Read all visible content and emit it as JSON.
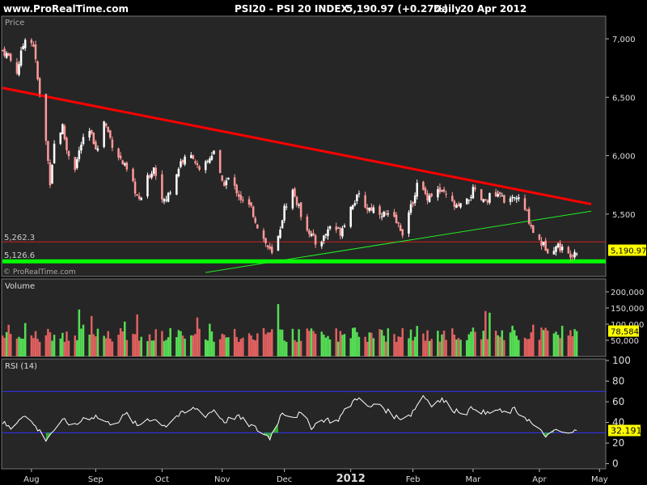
{
  "header": {
    "site": "www.ProRealTime.com",
    "instrument": "PSI20 - PSI 20 INDEX",
    "quote": "5,190.97 (+0.27%)",
    "period": "Daily",
    "date": "20 Apr 2012"
  },
  "panels": {
    "price_label": "Price",
    "volume_label": "Volume",
    "rsi_label": "RSI (14)",
    "watermark": "© ProRealTime.com"
  },
  "colors": {
    "background": "#000000",
    "panel_bg": "#262626",
    "up_candle": "#ffffff",
    "down_candle": "#ff9999",
    "up_volume": "#55dd55",
    "down_volume": "#e06060",
    "trendline_red": "#ff0000",
    "trendline_green": "#22ee22",
    "support": "#00ff00",
    "ref_line": "#cc2222",
    "rsi_line": "#ffffff",
    "rsi_bands": "#3333ff",
    "last_value_box": "#ffff00"
  },
  "chart_data": [
    {
      "type": "candlestick",
      "panel": "price",
      "title": "PSI20 - PSI 20 INDEX",
      "y_ticks": [
        "7,000",
        "6,500",
        "6,000",
        "5,500"
      ],
      "y_tick_values": [
        7000,
        6500,
        6000,
        5500
      ],
      "ylim": [
        4980,
        7180
      ],
      "x_ticks": [
        "Aug",
        "Sep",
        "Oct",
        "Nov",
        "Dec",
        "2012",
        "Feb",
        "Mar",
        "Apr",
        "May"
      ],
      "date_range": [
        "2011-07-18",
        "2012-04-20"
      ],
      "last_value": "5,190.97",
      "ref_levels": [
        {
          "label": "5,262.3",
          "value": 5262.3,
          "color": "#cc2222"
        },
        {
          "label": "5,126.6",
          "value": 5126.6,
          "color": "#00ff00"
        }
      ],
      "trendlines": [
        {
          "name": "resistance",
          "color": "#ff0000",
          "from": [
            "2011-07-18",
            6580
          ],
          "to": [
            "2012-04-27",
            5585
          ]
        },
        {
          "name": "support",
          "color": "#22ee22",
          "from": [
            "2011-10-24",
            5000
          ],
          "to": [
            "2012-04-27",
            5525
          ]
        }
      ],
      "close_path": [
        [
          "2011-07-18",
          6900
        ],
        [
          "2011-07-21",
          6850
        ],
        [
          "2011-07-25",
          6720
        ],
        [
          "2011-07-29",
          7020
        ],
        [
          "2011-08-02",
          6950
        ],
        [
          "2011-08-04",
          6650
        ],
        [
          "2011-08-08",
          6120
        ],
        [
          "2011-08-10",
          5780
        ],
        [
          "2011-08-12",
          6100
        ],
        [
          "2011-08-16",
          6250
        ],
        [
          "2011-08-18",
          6050
        ],
        [
          "2011-08-22",
          5900
        ],
        [
          "2011-08-25",
          6100
        ],
        [
          "2011-08-29",
          6200
        ],
        [
          "2011-09-02",
          6050
        ],
        [
          "2011-09-05",
          6300
        ],
        [
          "2011-09-09",
          6100
        ],
        [
          "2011-09-12",
          6000
        ],
        [
          "2011-09-15",
          5900
        ],
        [
          "2011-09-19",
          5750
        ],
        [
          "2011-09-22",
          5600
        ],
        [
          "2011-09-26",
          5800
        ],
        [
          "2011-09-29",
          5900
        ],
        [
          "2011-10-04",
          5600
        ],
        [
          "2011-10-07",
          5700
        ],
        [
          "2011-10-12",
          5950
        ],
        [
          "2011-10-18",
          6000
        ],
        [
          "2011-10-21",
          5850
        ],
        [
          "2011-10-25",
          5950
        ],
        [
          "2011-10-28",
          6050
        ],
        [
          "2011-11-01",
          5750
        ],
        [
          "2011-11-04",
          5800
        ],
        [
          "2011-11-08",
          5700
        ],
        [
          "2011-11-11",
          5600
        ],
        [
          "2011-11-15",
          5550
        ],
        [
          "2011-11-18",
          5400
        ],
        [
          "2011-11-22",
          5250
        ],
        [
          "2011-11-25",
          5150
        ],
        [
          "2011-11-28",
          5300
        ],
        [
          "2011-12-01",
          5550
        ],
        [
          "2011-12-05",
          5700
        ],
        [
          "2011-12-09",
          5500
        ],
        [
          "2011-12-13",
          5350
        ],
        [
          "2011-12-16",
          5250
        ],
        [
          "2011-12-20",
          5300
        ],
        [
          "2011-12-23",
          5400
        ],
        [
          "2011-12-28",
          5350
        ],
        [
          "2012-01-03",
          5600
        ],
        [
          "2012-01-06",
          5650
        ],
        [
          "2012-01-10",
          5550
        ],
        [
          "2012-01-13",
          5550
        ],
        [
          "2012-01-18",
          5500
        ],
        [
          "2012-01-23",
          5450
        ],
        [
          "2012-01-27",
          5350
        ],
        [
          "2012-01-31",
          5550
        ],
        [
          "2012-02-03",
          5750
        ],
        [
          "2012-02-08",
          5650
        ],
        [
          "2012-02-13",
          5700
        ],
        [
          "2012-02-17",
          5650
        ],
        [
          "2012-02-22",
          5550
        ],
        [
          "2012-02-27",
          5600
        ],
        [
          "2012-03-01",
          5700
        ],
        [
          "2012-03-06",
          5600
        ],
        [
          "2012-03-09",
          5650
        ],
        [
          "2012-03-14",
          5650
        ],
        [
          "2012-03-19",
          5600
        ],
        [
          "2012-03-22",
          5650
        ],
        [
          "2012-03-27",
          5500
        ],
        [
          "2012-03-30",
          5350
        ],
        [
          "2012-04-03",
          5250
        ],
        [
          "2012-04-06",
          5200
        ],
        [
          "2012-04-11",
          5230
        ],
        [
          "2012-04-16",
          5150
        ],
        [
          "2012-04-20",
          5190.97
        ]
      ]
    },
    {
      "type": "bar",
      "panel": "volume",
      "y_ticks": [
        "200,000",
        "150,000",
        "100,000",
        "50,000"
      ],
      "y_tick_values": [
        200000,
        150000,
        100000,
        50000
      ],
      "ylim": [
        0,
        235000
      ],
      "last_value": "78,584"
    },
    {
      "type": "line",
      "panel": "rsi",
      "name": "RSI (14)",
      "y_ticks": [
        "100",
        "80",
        "60",
        "40",
        "20",
        "0"
      ],
      "y_tick_values": [
        100,
        80,
        60,
        40,
        20,
        0
      ],
      "ylim": [
        -5,
        100
      ],
      "bands": [
        70,
        30
      ],
      "last_value": "32.191",
      "path": [
        [
          "2011-07-18",
          40
        ],
        [
          "2011-07-22",
          34
        ],
        [
          "2011-07-28",
          48
        ],
        [
          "2011-08-02",
          38
        ],
        [
          "2011-08-08",
          24
        ],
        [
          "2011-08-12",
          33
        ],
        [
          "2011-08-17",
          42
        ],
        [
          "2011-08-22",
          36
        ],
        [
          "2011-08-26",
          44
        ],
        [
          "2011-09-01",
          46
        ],
        [
          "2011-09-07",
          39
        ],
        [
          "2011-09-12",
          42
        ],
        [
          "2011-09-16",
          48
        ],
        [
          "2011-09-21",
          36
        ],
        [
          "2011-09-26",
          44
        ],
        [
          "2011-09-30",
          42
        ],
        [
          "2011-10-05",
          37
        ],
        [
          "2011-10-10",
          46
        ],
        [
          "2011-10-14",
          49
        ],
        [
          "2011-10-19",
          54
        ],
        [
          "2011-10-24",
          47
        ],
        [
          "2011-10-28",
          52
        ],
        [
          "2011-11-02",
          41
        ],
        [
          "2011-11-08",
          46
        ],
        [
          "2011-11-14",
          38
        ],
        [
          "2011-11-18",
          33
        ],
        [
          "2011-11-24",
          25
        ],
        [
          "2011-11-30",
          50
        ],
        [
          "2011-12-05",
          46
        ],
        [
          "2011-12-09",
          48
        ],
        [
          "2011-12-14",
          36
        ],
        [
          "2011-12-20",
          43
        ],
        [
          "2011-12-26",
          41
        ],
        [
          "2012-01-03",
          60
        ],
        [
          "2012-01-06",
          66
        ],
        [
          "2012-01-10",
          54
        ],
        [
          "2012-01-16",
          58
        ],
        [
          "2012-01-20",
          50
        ],
        [
          "2012-01-25",
          44
        ],
        [
          "2012-01-31",
          48
        ],
        [
          "2012-02-06",
          66
        ],
        [
          "2012-02-10",
          58
        ],
        [
          "2012-02-15",
          62
        ],
        [
          "2012-02-21",
          52
        ],
        [
          "2012-02-27",
          50
        ],
        [
          "2012-03-02",
          55
        ],
        [
          "2012-03-07",
          48
        ],
        [
          "2012-03-12",
          52
        ],
        [
          "2012-03-16",
          49
        ],
        [
          "2012-03-21",
          52
        ],
        [
          "2012-03-27",
          44
        ],
        [
          "2012-03-30",
          37
        ],
        [
          "2012-04-03",
          30
        ],
        [
          "2012-04-06",
          27
        ],
        [
          "2012-04-11",
          32
        ],
        [
          "2012-04-16",
          28
        ],
        [
          "2012-04-20",
          32.19
        ]
      ]
    }
  ]
}
